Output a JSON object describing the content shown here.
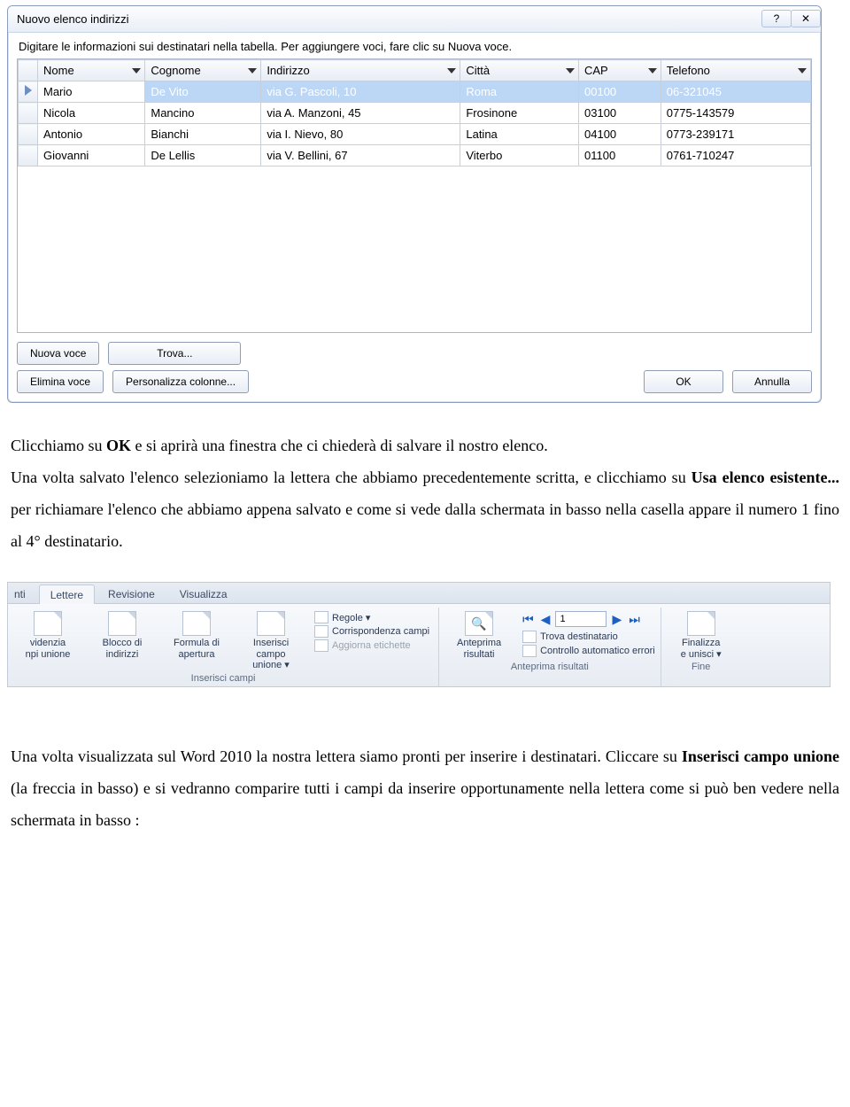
{
  "dialog": {
    "title": "Nuovo elenco indirizzi",
    "instruction": "Digitare le informazioni sui destinatari nella tabella. Per aggiungere voci, fare clic su Nuova voce.",
    "columns": [
      "Nome",
      "Cognome",
      "Indirizzo",
      "Città",
      "CAP",
      "Telefono"
    ],
    "rows": [
      {
        "selected": true,
        "cells": [
          "Mario",
          "De Vito",
          "via G. Pascoli, 10",
          "Roma",
          "00100",
          "06-321045"
        ]
      },
      {
        "selected": false,
        "cells": [
          "Nicola",
          "Mancino",
          "via A. Manzoni, 45",
          "Frosinone",
          "03100",
          "0775-143579"
        ]
      },
      {
        "selected": false,
        "cells": [
          "Antonio",
          "Bianchi",
          "via I. Nievo, 80",
          "Latina",
          "04100",
          "0773-239171"
        ]
      },
      {
        "selected": false,
        "cells": [
          "Giovanni",
          "De Lellis",
          "via V. Bellini, 67",
          "Viterbo",
          "01100",
          "0761-710247"
        ]
      }
    ],
    "buttons": {
      "new": "Nuova voce",
      "find": "Trova...",
      "delete": "Elimina voce",
      "customize": "Personalizza colonne...",
      "ok": "OK",
      "cancel": "Annulla"
    }
  },
  "doc": {
    "p1_a": "Clicchiamo su ",
    "p1_b": "OK",
    "p1_c": " e si aprirà una finestra che ci chiederà di salvare il nostro elenco.",
    "p2_a": "Una volta salvato l'elenco selezioniamo la lettera che abbiamo precedentemente scritta, e clicchiamo su ",
    "p2_b": "Usa elenco esistente...",
    "p2_c": " per richiamare l'elenco che abbiamo appena salvato e come si vede dalla schermata in basso nella casella appare il numero 1 fino al 4° destinatario.",
    "p3_a": "Una volta visualizzata sul Word 2010 la nostra lettera siamo pronti per inserire i destinatari. Cliccare su ",
    "p3_b": "Inserisci campo unione",
    "p3_c": " (la freccia in basso) e si vedranno comparire tutti i campi da inserire opportunamente nella lettera come si può ben vedere nella schermata in basso :"
  },
  "ribbon": {
    "tabs": {
      "cut": "nti",
      "active": "Lettere",
      "rev": "Revisione",
      "view": "Visualizza"
    },
    "group1": {
      "b1a": "videnzia",
      "b1b": "npi unione",
      "b2a": "Blocco di",
      "b2b": "indirizzi",
      "b3a": "Formula di",
      "b3b": "apertura",
      "b4a": "Inserisci campo",
      "b4b": "unione ▾",
      "s1": "Regole ▾",
      "s2": "Corrispondenza campi",
      "s3": "Aggiorna etichette",
      "label": "Inserisci campi"
    },
    "group2": {
      "btn_a": "Anteprima",
      "btn_b": "risultati",
      "nav_value": "1",
      "find": "Trova destinatario",
      "check": "Controllo automatico errori",
      "label": "Anteprima risultati"
    },
    "group3": {
      "btn_a": "Finalizza",
      "btn_b": "e unisci ▾",
      "label": "Fine"
    }
  }
}
